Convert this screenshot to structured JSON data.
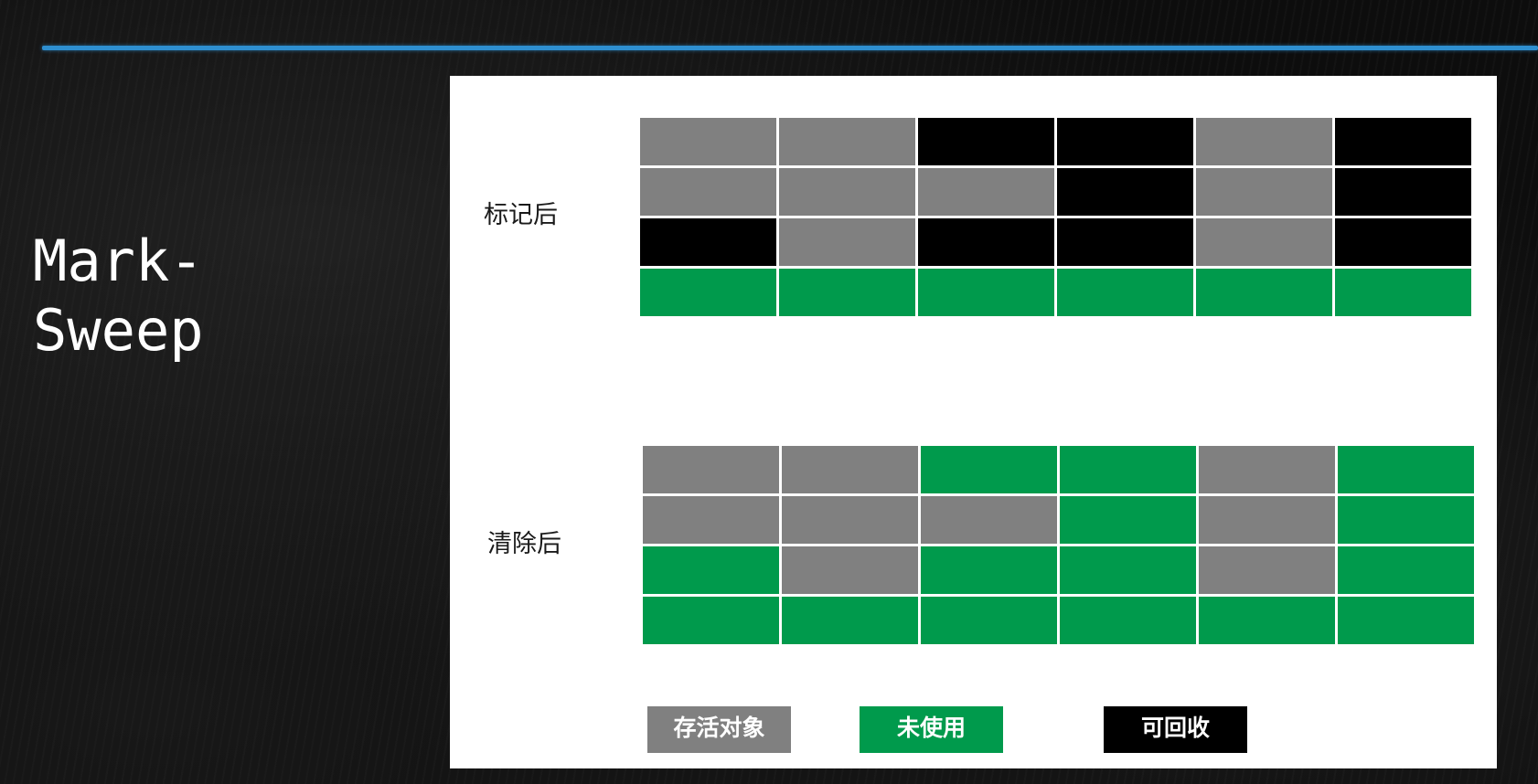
{
  "slide": {
    "title_line1": "Mark-",
    "title_line2": "Sweep"
  },
  "diagram": {
    "marked_label": "标记后",
    "swept_label": "清除后",
    "colors": {
      "live": "#808080",
      "free": "#009a4c",
      "garbage": "#000000",
      "accent_line": "#2e8fd0"
    },
    "marked_grid": [
      [
        "live",
        "live",
        "garbage",
        "garbage",
        "live",
        "garbage"
      ],
      [
        "live",
        "live",
        "live",
        "garbage",
        "live",
        "garbage"
      ],
      [
        "garbage",
        "live",
        "garbage",
        "garbage",
        "live",
        "garbage"
      ],
      [
        "free",
        "free",
        "free",
        "free",
        "free",
        "free"
      ]
    ],
    "swept_grid": [
      [
        "live",
        "live",
        "free",
        "free",
        "live",
        "free"
      ],
      [
        "live",
        "live",
        "live",
        "free",
        "live",
        "free"
      ],
      [
        "free",
        "live",
        "free",
        "free",
        "live",
        "free"
      ],
      [
        "free",
        "free",
        "free",
        "free",
        "free",
        "free"
      ]
    ]
  },
  "legend": {
    "live": "存活对象",
    "free": "未使用",
    "garbage": "可回收"
  }
}
